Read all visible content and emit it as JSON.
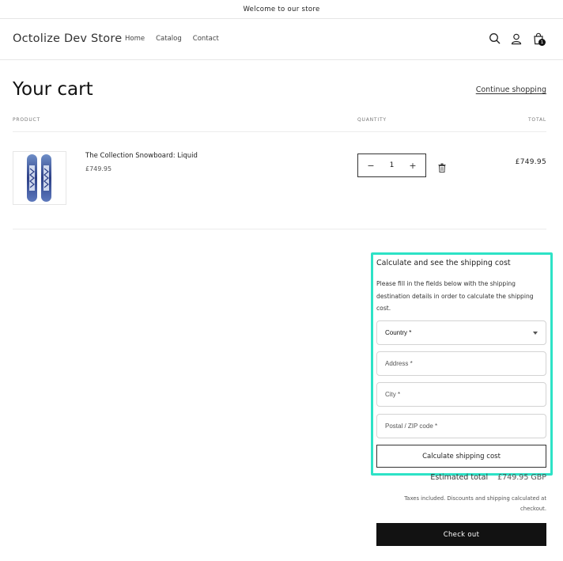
{
  "announcement": "Welcome to our store",
  "header": {
    "store_name": "Octolize Dev Store",
    "nav": [
      "Home",
      "Catalog",
      "Contact"
    ],
    "icons": [
      "search-icon",
      "account-icon",
      "cart-icon"
    ],
    "cart_count": "1"
  },
  "cart": {
    "title": "Your cart",
    "continue_label": "Continue shopping",
    "columns": {
      "product": "PRODUCT",
      "quantity": "QUANTITY",
      "total": "TOTAL"
    },
    "item": {
      "name": "The Collection Snowboard: Liquid",
      "price": "£749.95",
      "quantity": "1",
      "total": "£749.95"
    }
  },
  "shipping": {
    "title": "Calculate and see the shipping cost",
    "description": "Please fill in the fields below with the shipping destination details in order to calculate the shipping cost.",
    "country_label": "Country *",
    "address_placeholder": "Address *",
    "city_placeholder": "City *",
    "zip_placeholder": "Postal / ZIP code *",
    "button_label": "Calculate shipping cost",
    "highlight_color": "#2de2c6"
  },
  "summary": {
    "estimated_label": "Estimated total",
    "estimated_value": "£749.95 GBP",
    "tax_note": "Taxes included. Discounts and shipping calculated at checkout.",
    "checkout_label": "Check out"
  }
}
